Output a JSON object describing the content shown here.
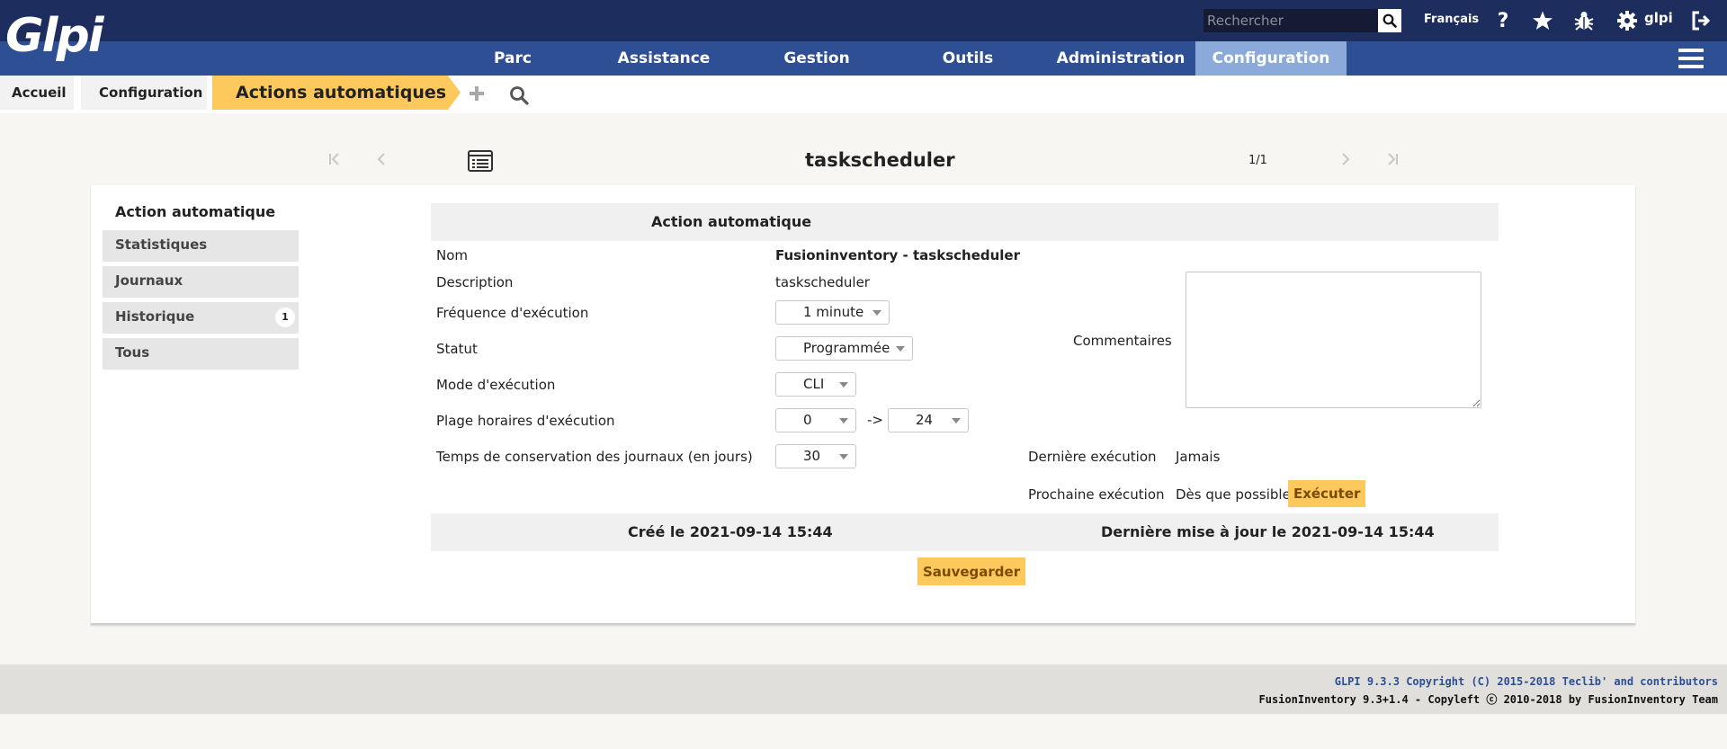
{
  "header": {
    "logo_text": "Glpi",
    "search_placeholder": "Rechercher",
    "language": "Français",
    "user": "glpi"
  },
  "menu": [
    {
      "label": "Parc"
    },
    {
      "label": "Assistance"
    },
    {
      "label": "Gestion"
    },
    {
      "label": "Outils"
    },
    {
      "label": "Administration"
    },
    {
      "label": "Configuration"
    }
  ],
  "breadcrumb": {
    "home": "Accueil",
    "section": "Configuration",
    "current": "Actions automatiques"
  },
  "nav": {
    "title": "taskscheduler",
    "counter": "1/1"
  },
  "tabs": {
    "active": "Action automatique",
    "items": [
      {
        "label": "Statistiques"
      },
      {
        "label": "Journaux"
      },
      {
        "label": "Historique",
        "badge": "1"
      },
      {
        "label": "Tous"
      }
    ]
  },
  "form": {
    "header": "Action automatique",
    "name_label": "Nom",
    "name_value": "Fusioninventory - taskscheduler",
    "description_label": "Description",
    "description_value": "taskscheduler",
    "frequency_label": "Fréquence d'exécution",
    "frequency_value": "1 minute",
    "status_label": "Statut",
    "status_value": "Programmée",
    "mode_label": "Mode d'exécution",
    "mode_value": "CLI",
    "range_label": "Plage horaires d'exécution",
    "range_from": "0",
    "range_sep": "->",
    "range_to": "24",
    "retention_label": "Temps de conservation des journaux (en jours)",
    "retention_value": "30",
    "comments_label": "Commentaires",
    "last_run_label": "Dernière exécution",
    "last_run_value": "Jamais",
    "next_run_label": "Prochaine exécution",
    "next_run_value": "Dès que possible",
    "execute_button": "Exécuter",
    "created": "Créé le 2021-09-14 15:44",
    "updated": "Dernière mise à jour le 2021-09-14 15:44",
    "save_button": "Sauvegarder"
  },
  "footer": {
    "line1": "GLPI 9.3.3 Copyright (C) 2015-2018 Teclib' and contributors",
    "line2": "FusionInventory 9.3+1.4 - Copyleft ⓒ 2010-2018 by FusionInventory Team"
  },
  "colors": {
    "header_dark": "#1d2d5e",
    "header_nav": "#2e4f94",
    "active_menu": "#8ba9d9",
    "accent": "#fec95c"
  }
}
